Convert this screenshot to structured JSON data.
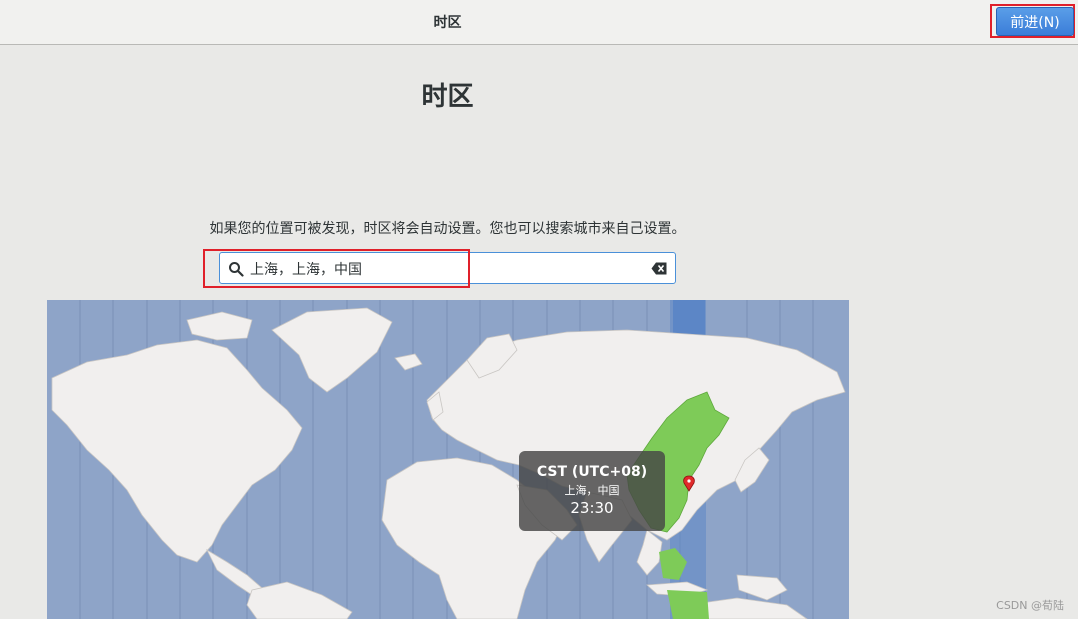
{
  "header": {
    "title": "时区",
    "next_label": "前进(N)"
  },
  "page": {
    "title": "时区",
    "hint": "如果您的位置可被发现，时区将会自动设置。您也可以搜索城市来自己设置。"
  },
  "search": {
    "value": "上海，上海，中国",
    "search_icon": "search-icon",
    "clear_icon": "clear-text-icon"
  },
  "map": {
    "ocean_color": "#8ea4c8",
    "land_color": "#f1efee",
    "selected_zone_color": "#7ecb58",
    "zone_band_color": "#5c86c6",
    "marker_color": "#e02a2a"
  },
  "tooltip": {
    "zone": "CST (UTC+08)",
    "city": "上海，中国",
    "time": "23:30"
  },
  "watermark": "CSDN @荀陆"
}
